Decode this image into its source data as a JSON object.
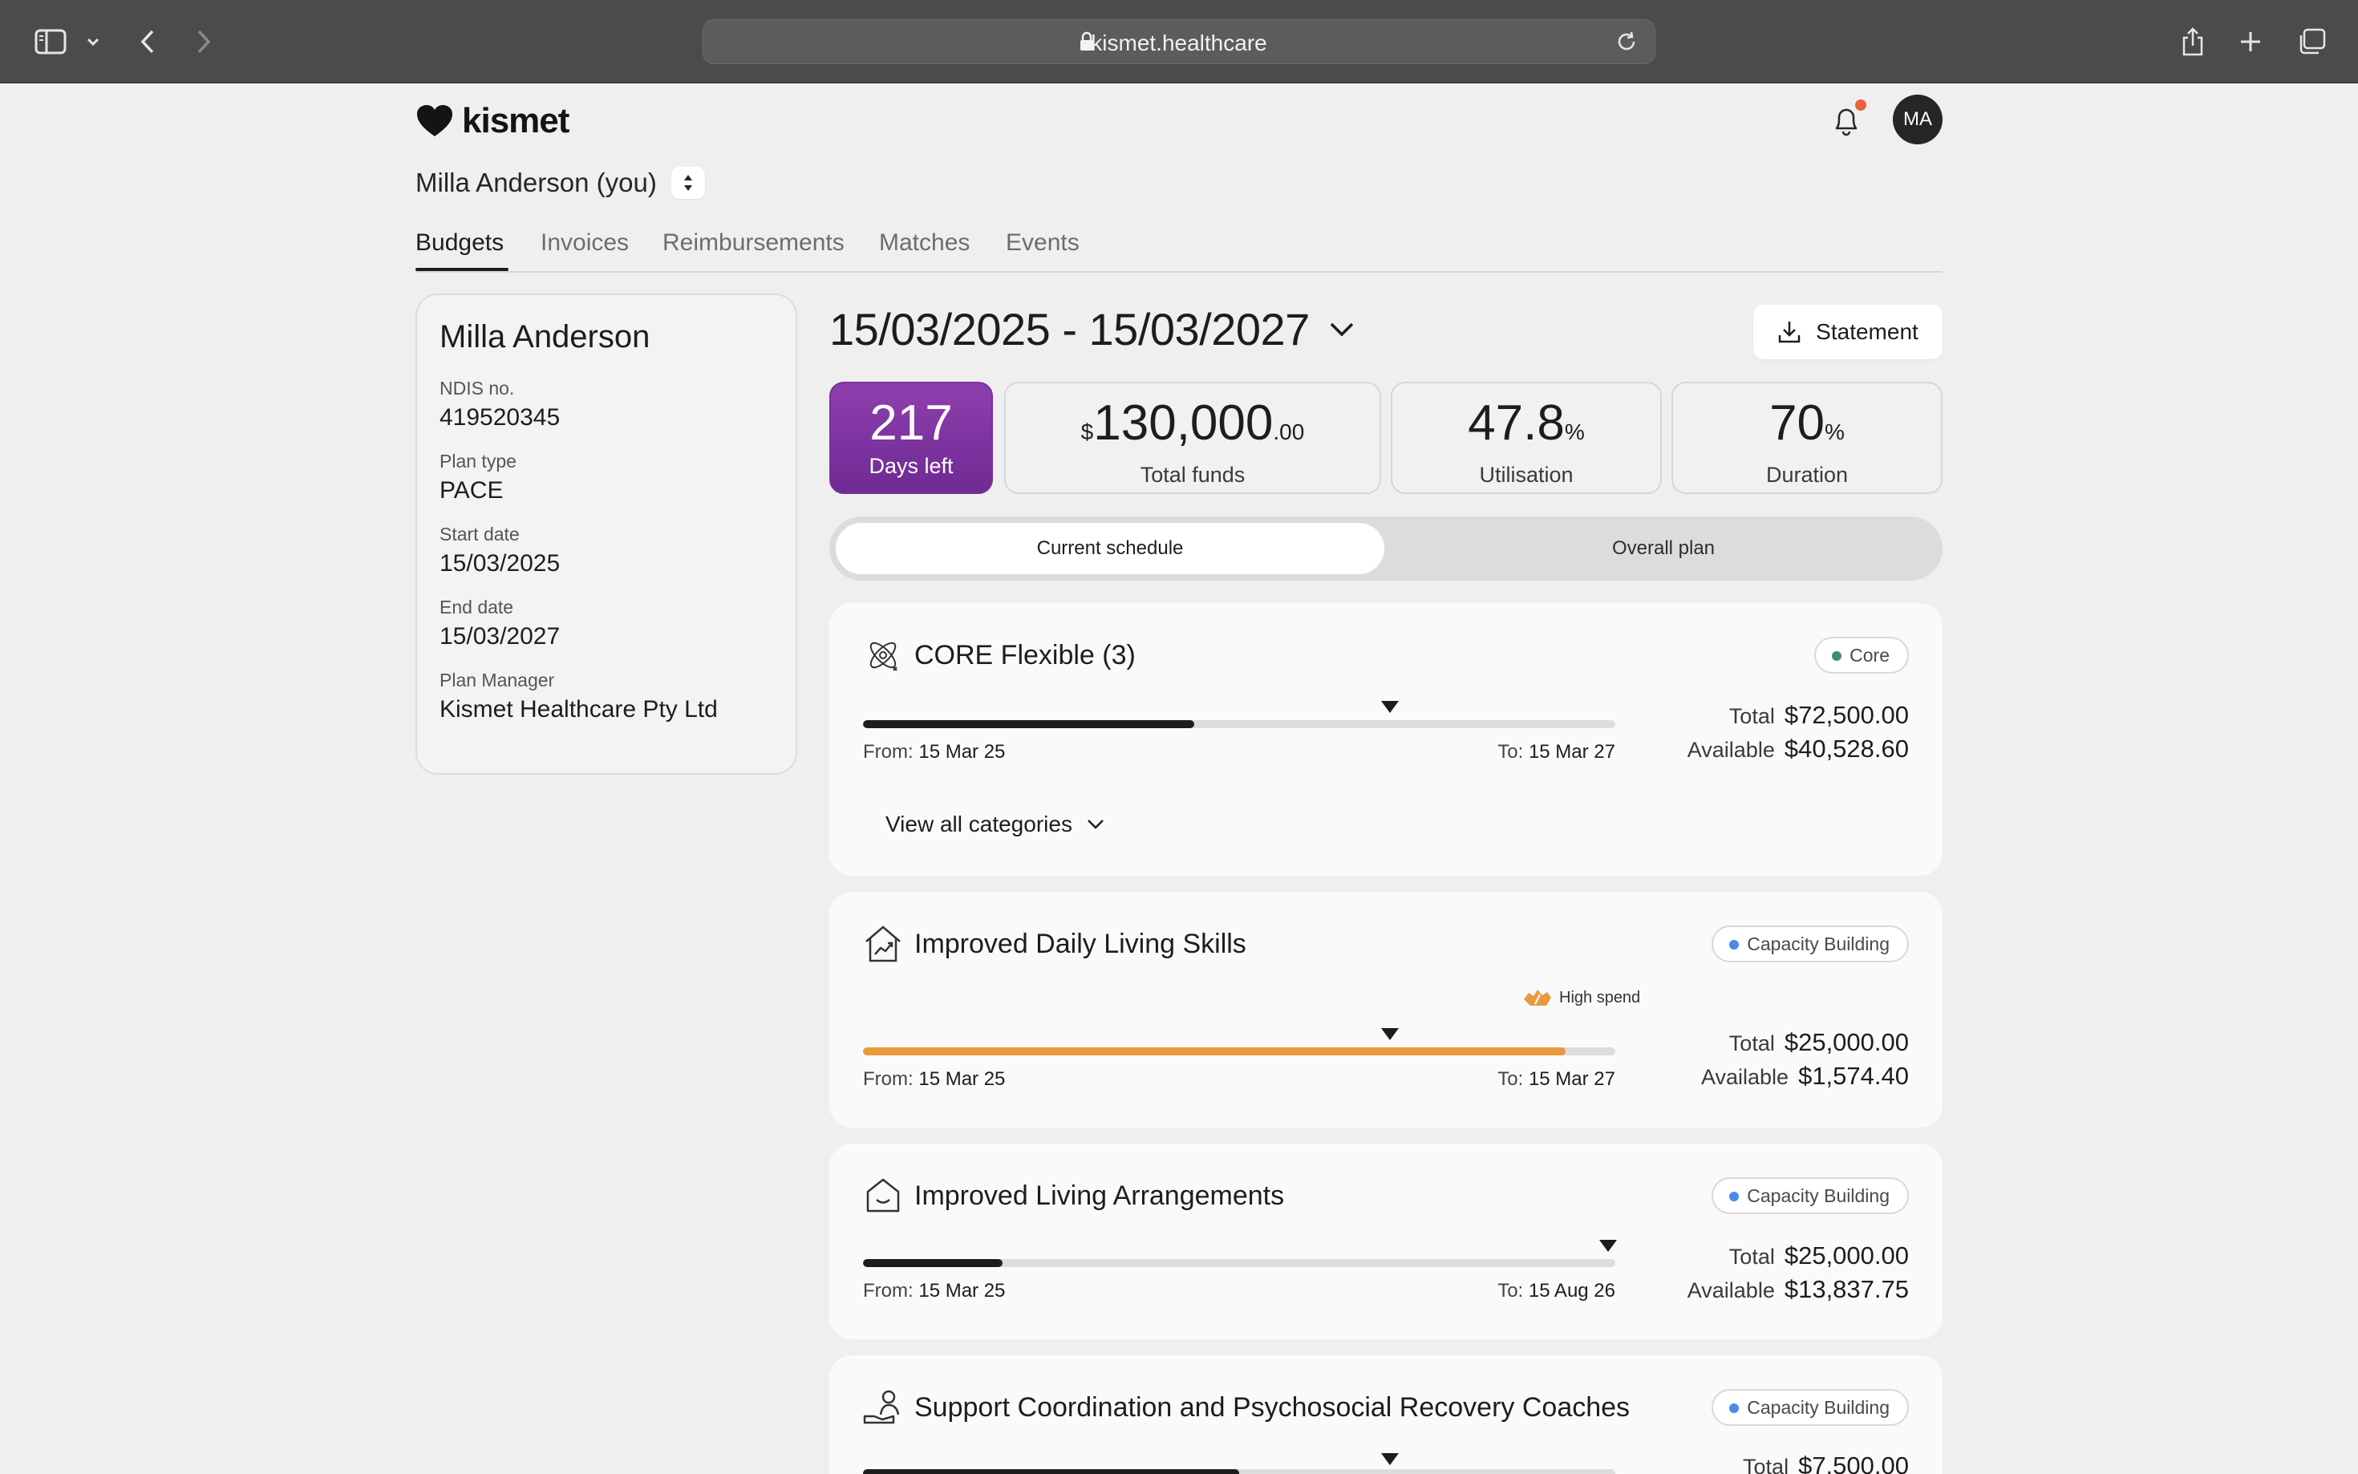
{
  "browser": {
    "url": "kismet.healthcare"
  },
  "app": {
    "logo_text": "kismet",
    "avatar_initials": "MA",
    "person_name": "Milla Anderson (you)"
  },
  "tabs": [
    {
      "label": "Budgets",
      "active": true
    },
    {
      "label": "Invoices",
      "active": false
    },
    {
      "label": "Reimbursements",
      "active": false
    },
    {
      "label": "Matches",
      "active": false
    },
    {
      "label": "Events",
      "active": false
    }
  ],
  "participant": {
    "name": "Milla Anderson",
    "fields": [
      {
        "label": "NDIS no.",
        "value": "419520345"
      },
      {
        "label": "Plan type",
        "value": "PACE"
      },
      {
        "label": "Start date",
        "value": "15/03/2025"
      },
      {
        "label": "End date",
        "value": "15/03/2027"
      },
      {
        "label": "Plan Manager",
        "value": "Kismet Healthcare Pty Ltd"
      }
    ]
  },
  "plan": {
    "period": "15/03/2025 - 15/03/2027",
    "statement_label": "Statement",
    "stats": {
      "days_left": {
        "value": "217",
        "caption": "Days left"
      },
      "total_funds": {
        "currency": "$",
        "value": "130,000",
        "cents": ".00",
        "caption": "Total funds"
      },
      "utilisation": {
        "value": "47.8",
        "unit": "%",
        "caption": "Utilisation"
      },
      "duration": {
        "value": "70",
        "unit": "%",
        "caption": "Duration"
      }
    },
    "schedule_toggle": {
      "active": "Current schedule",
      "other": "Overall plan"
    }
  },
  "budgets": [
    {
      "title": "CORE Flexible (3)",
      "tag": "Core",
      "tag_color": "#3e8e6e",
      "progress": 0.44,
      "marker": 0.7,
      "bar_color": "#1d1d1d",
      "from_label": "From:",
      "from": "15 Mar 25",
      "to_label": "To:",
      "to": "15 Mar 27",
      "total_label": "Total",
      "total": "$72,500.00",
      "available_label": "Available",
      "available": "$40,528.60",
      "view_all": "View all categories"
    },
    {
      "title": "Improved Daily Living Skills",
      "tag": "Capacity Building",
      "tag_color": "#4a8ae8",
      "progress": 0.934,
      "marker": 0.7,
      "bar_color": "#e89a3c",
      "flag": "High spend",
      "from_label": "From:",
      "from": "15 Mar 25",
      "to_label": "To:",
      "to": "15 Mar 27",
      "total_label": "Total",
      "total": "$25,000.00",
      "available_label": "Available",
      "available": "$1,574.40"
    },
    {
      "title": "Improved Living Arrangements",
      "tag": "Capacity Building",
      "tag_color": "#4a8ae8",
      "progress": 0.185,
      "marker": 0.99,
      "bar_color": "#1d1d1d",
      "from_label": "From:",
      "from": "15 Mar 25",
      "to_label": "To:",
      "to": "15 Aug 26",
      "total_label": "Total",
      "total": "$25,000.00",
      "available_label": "Available",
      "available": "$13,837.75"
    },
    {
      "title": "Support Coordination and Psychosocial Recovery Coaches",
      "tag": "Capacity Building",
      "tag_color": "#4a8ae8",
      "progress": 0.5,
      "marker": 0.7,
      "bar_color": "#1d1d1d",
      "total_label": "Total",
      "total": "$7,500.00"
    }
  ]
}
